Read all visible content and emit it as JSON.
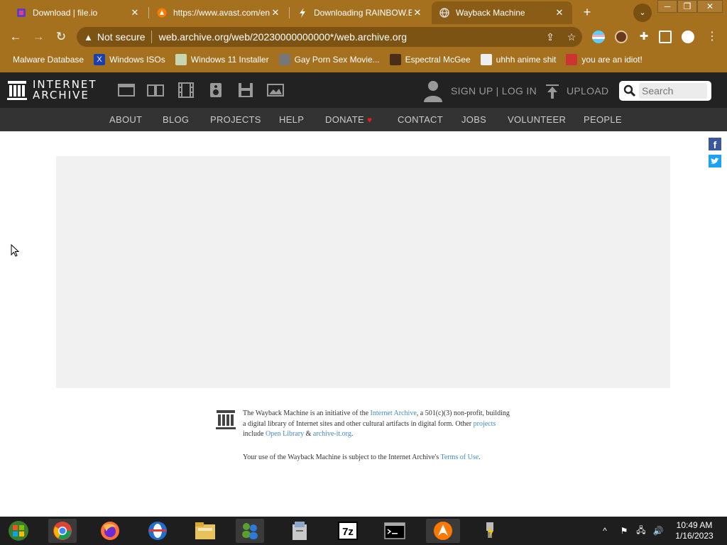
{
  "browser": {
    "tabs": [
      {
        "title": "Download | file.io",
        "close": "✕"
      },
      {
        "title": "https://www.avast.com/en-",
        "close": "✕"
      },
      {
        "title": "Downloading RAINBOW.E",
        "close": "✕"
      },
      {
        "title": "Wayback Machine",
        "close": "✕"
      }
    ],
    "new_tab": "+",
    "window": {
      "minimize": "─",
      "restore": "❐",
      "close": "✕"
    },
    "nav": {
      "back": "←",
      "forward": "→",
      "reload": "↻"
    },
    "omnibox": {
      "security_label": "Not secure",
      "url": "web.archive.org/web/20230000000000*/web.archive.org"
    },
    "bookmarks": [
      {
        "label": "Malware Database"
      },
      {
        "label": "Windows ISOs"
      },
      {
        "label": "Windows 11 Installer"
      },
      {
        "label": "Gay Porn Sex Movie..."
      },
      {
        "label": "Espectral McGee"
      },
      {
        "label": "uhhh anime shit"
      },
      {
        "label": "you are an idiot!"
      }
    ]
  },
  "ia": {
    "logo_line1": "INTERNET",
    "logo_line2": "ARCHIVE",
    "signup": "SIGN UP | LOG IN",
    "upload": "UPLOAD",
    "search_placeholder": "Search",
    "nav": [
      "ABOUT",
      "BLOG",
      "PROJECTS",
      "HELP",
      "DONATE",
      "CONTACT",
      "JOBS",
      "VOLUNTEER",
      "PEOPLE"
    ],
    "facebook": "f"
  },
  "footer": {
    "t1": "The Wayback Machine is an initiative of the ",
    "l1": "Internet Archive",
    "t2": ", a 501(c)(3) non-profit, building a digital library of Internet sites and other cultural artifacts in digital form. Other ",
    "l2": "projects",
    "t3": " include ",
    "l3": "Open Library",
    "t4": " & ",
    "l4": "archive-it.org",
    "t5": ".",
    "terms_text": "Your use of the Wayback Machine is subject to the Internet Archive's ",
    "terms_link": "Terms of Use",
    "terms_end": "."
  },
  "taskbar": {
    "time": "10:49 AM",
    "date": "1/16/2023",
    "seven_zip": "7z",
    "tray_chevron": "^"
  },
  "colors": {
    "chrome_frame": "#a6711f",
    "ia_header": "#222222",
    "ia_nav": "#333333",
    "link": "#428bca"
  }
}
